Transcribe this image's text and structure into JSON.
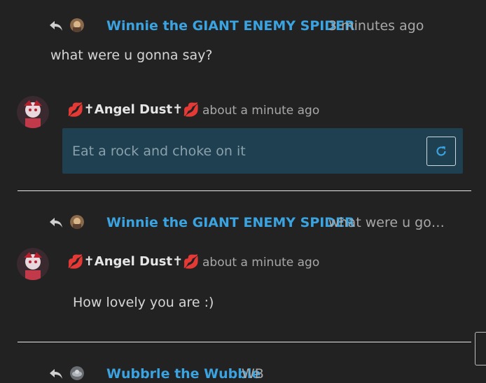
{
  "comments": [
    {
      "author": "Winnie the GIANT ENEMY SPIDER",
      "time": "3 minutes ago",
      "text": "what were u gonna say?"
    },
    {
      "author": "Angel Dust",
      "time": "about a minute ago",
      "edit_value": "Eat a rock and choke on it"
    },
    {
      "reply_author": "Winnie the GIANT ENEMY SPIDER",
      "reply_preview": "what were u gonna say?",
      "author": "Angel Dust",
      "time": "about a minute ago",
      "text": "How lovely you are :)"
    },
    {
      "author": "Wubbrle the Wubble",
      "preview": "WB"
    }
  ],
  "icons": {
    "reply": "reply-icon",
    "refresh": "refresh-icon",
    "lips": "kiss-mark-icon",
    "cross": "cross-icon"
  },
  "colors": {
    "background": "#222222",
    "link": "#3aa3e0",
    "edit_box": "#1f4050",
    "lips": "#e23b4e"
  }
}
